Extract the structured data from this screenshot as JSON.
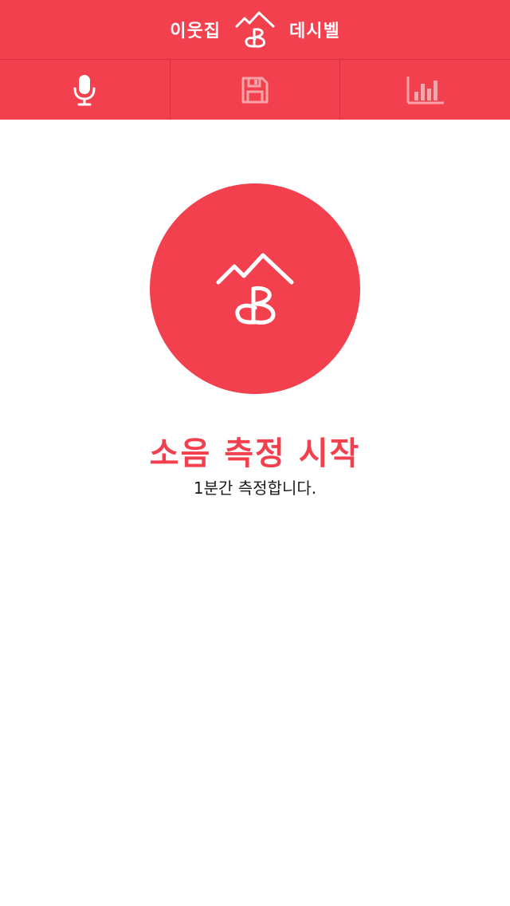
{
  "header": {
    "title_left": "이웃집",
    "title_right": "데시벨",
    "logo_icon": "mountain-heart-logo-icon"
  },
  "tabs": [
    {
      "icon": "microphone-icon",
      "state": "active"
    },
    {
      "icon": "floppy-disk-icon",
      "state": "inactive"
    },
    {
      "icon": "bar-chart-icon",
      "state": "inactive"
    }
  ],
  "main": {
    "start_icon": "mountain-heart-logo-icon",
    "start_title": "소음 측정 시작",
    "start_subtitle": "1분간 측정합니다."
  },
  "colors": {
    "brand": "#f2404e",
    "icon_active": "#ffffff",
    "icon_inactive": "#f7a3aa"
  }
}
